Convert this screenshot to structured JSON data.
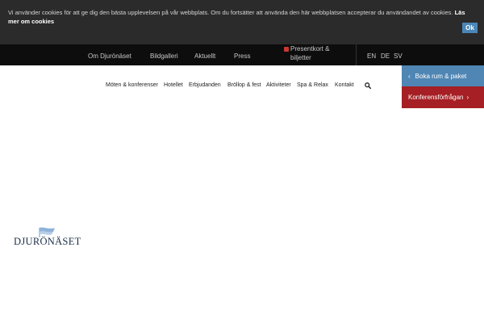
{
  "cookie": {
    "text": "Vi använder cookies för att ge dig den bästa upplevelsen på vår webbplats. Om du fortsätter att använda den här webbplatsen accepterar du användandet av cookies.",
    "more_link": "Läs mer om cookies",
    "ok_label": "Ok"
  },
  "topnav": {
    "items": [
      "Om Djurönäset",
      "Bildgalleri",
      "Aktuellt",
      "Press"
    ],
    "gift_label": "Presentkort & biljetter",
    "languages": [
      "EN",
      "DE",
      "SV"
    ]
  },
  "mainnav": {
    "items": [
      "Möten & konferenser",
      "Hotellet",
      "Erbjudanden",
      "Bröllop & fest",
      "Aktiviteter",
      "Spa & Relax",
      "Kontakt"
    ]
  },
  "side_buttons": {
    "boka_label": "Boka rum & paket",
    "konferens_label": "Konferensförfrågan"
  },
  "logo": {
    "text": "DJURÖNÄSET"
  },
  "colors": {
    "cookie_bg": "#2b2b2b",
    "topnav_bg": "#0d0d0d",
    "accent_blue": "#4f86b4",
    "accent_red": "#a51f24",
    "gift_red": "#c83732"
  }
}
